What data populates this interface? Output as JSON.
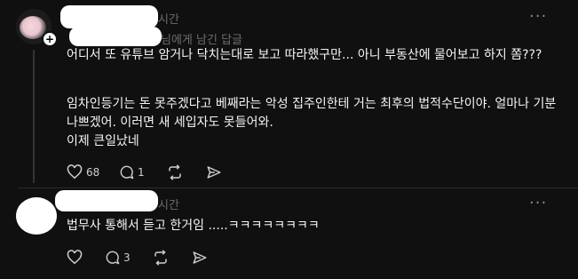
{
  "comment1": {
    "time_suffix": "시간",
    "reply_to": "님에게 남긴 답글",
    "paragraph1": "어디서 또 유튜브 암거나 닥치는대로 보고 따라했구만... 아니 부동산에 물어보고 하지 쫌???",
    "paragraph2": "임차인등기는 돈 못주겠다고 베째라는 악성 집주인한테 거는 최후의 법적수단이야. 얼마나 기분 나쁘겠어. 이러면 새 세입자도 못들어와.",
    "paragraph3": "이제 큰일났네",
    "likes": "68",
    "comments": "1",
    "more": "···"
  },
  "comment2": {
    "time_suffix": "시간",
    "text": "법무사 통해서 듣고 한거임 .....ㅋㅋㅋㅋㅋㅋㅋㅋ",
    "likes": "",
    "comments": "3",
    "more": "···"
  },
  "avatar_badge": "+"
}
